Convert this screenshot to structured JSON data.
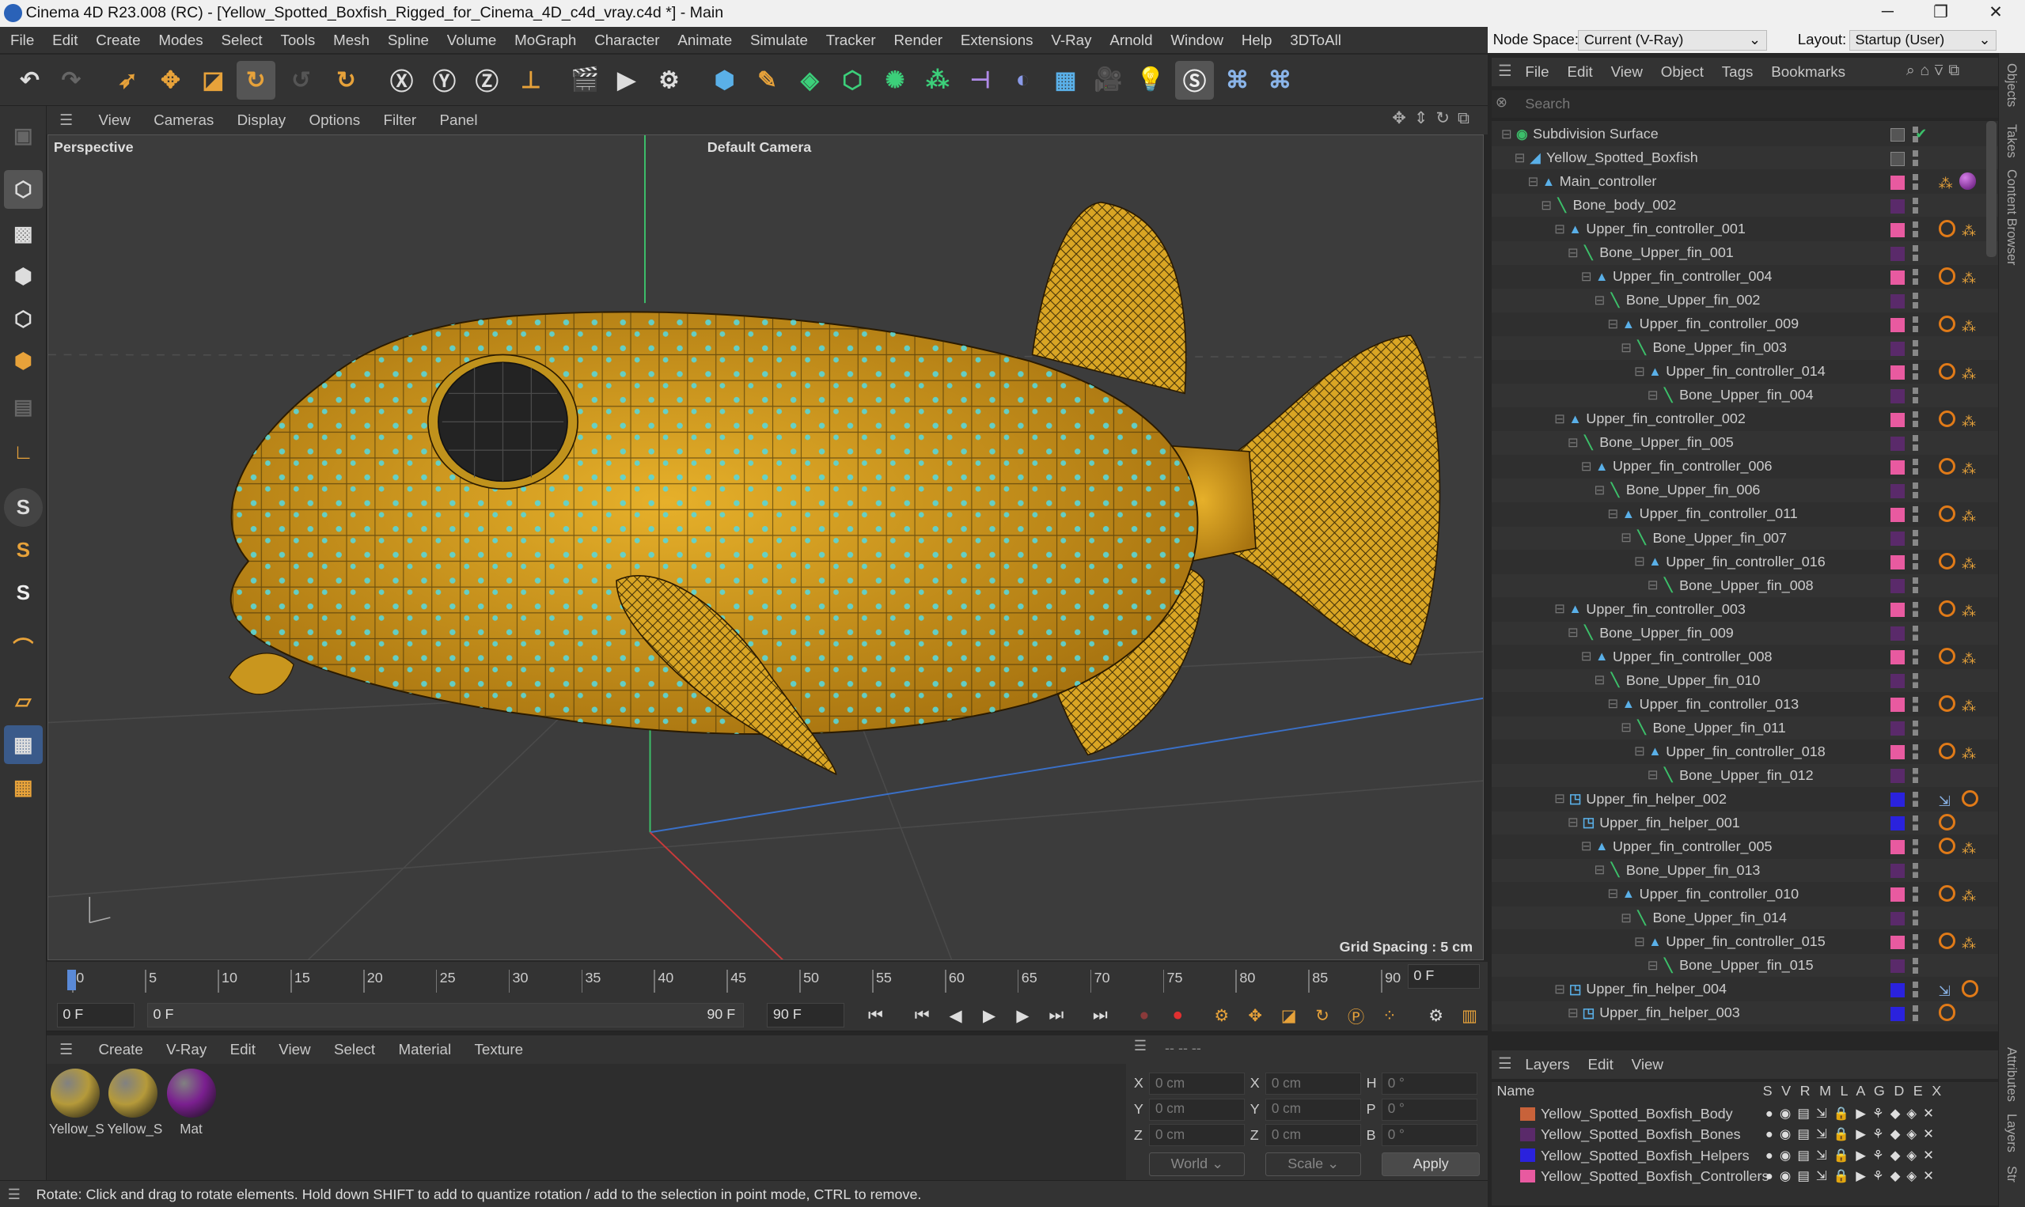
{
  "title_bar": {
    "text": "Cinema 4D R23.008 (RC) - [Yellow_Spotted_Boxfish_Rigged_for_Cinema_4D_c4d_vray.c4d *] - Main",
    "minimize": "─",
    "maximize": "❐",
    "close": "✕"
  },
  "menubar": [
    "File",
    "Edit",
    "Create",
    "Modes",
    "Select",
    "Tools",
    "Mesh",
    "Spline",
    "Volume",
    "MoGraph",
    "Character",
    "Animate",
    "Simulate",
    "Tracker",
    "Render",
    "Extensions",
    "V-Ray",
    "Arnold",
    "Window",
    "Help",
    "3DToAll"
  ],
  "node_space": {
    "label": "Node Space:",
    "value": "Current (V-Ray)"
  },
  "layout": {
    "label": "Layout:",
    "value": "Startup (User)"
  },
  "viewport": {
    "menu": [
      "View",
      "Cameras",
      "Display",
      "Options",
      "Filter",
      "Panel"
    ],
    "label": "Perspective",
    "camera": "Default Camera",
    "grid_spacing": "Grid Spacing : 5 cm"
  },
  "timeline": {
    "ticks": [
      "0",
      "5",
      "10",
      "15",
      "20",
      "25",
      "30",
      "35",
      "40",
      "45",
      "50",
      "55",
      "60",
      "65",
      "70",
      "75",
      "80",
      "85",
      "90"
    ],
    "current_frame": "0 F",
    "start_field": "0 F",
    "range_start": "0 F",
    "range_end": "90 F",
    "end_field": "90 F"
  },
  "material_manager": {
    "menu": [
      "Create",
      "V-Ray",
      "Edit",
      "View",
      "Select",
      "Material",
      "Texture"
    ],
    "materials": [
      {
        "name": "Yellow_S",
        "color": "#b59a3a"
      },
      {
        "name": "Yellow_S",
        "color": "#b59a3a"
      },
      {
        "name": "Mat",
        "color": "#7a1f8f"
      }
    ]
  },
  "coordinates": {
    "header": "--                --                --",
    "rows": [
      {
        "l1": "X",
        "v1": "0 cm",
        "l2": "X",
        "v2": "0 cm",
        "l3": "H",
        "v3": "0 °"
      },
      {
        "l1": "Y",
        "v1": "0 cm",
        "l2": "Y",
        "v2": "0 cm",
        "l3": "P",
        "v3": "0 °"
      },
      {
        "l1": "Z",
        "v1": "0 cm",
        "l2": "Z",
        "v2": "0 cm",
        "l3": "B",
        "v3": "0 °"
      }
    ],
    "world": "World",
    "scale": "Scale",
    "apply": "Apply"
  },
  "status": "Rotate: Click and drag to rotate elements. Hold down SHIFT to add to quantize rotation / add to the selection in point mode, CTRL to remove.",
  "object_manager": {
    "menu": [
      "File",
      "Edit",
      "View",
      "Object",
      "Tags",
      "Bookmarks"
    ],
    "search_placeholder": "Search",
    "tree": [
      {
        "name": "Subdivision Surface",
        "depth": 0,
        "kind": "subd",
        "layer": "",
        "tags": "check"
      },
      {
        "name": "Yellow_Spotted_Boxfish",
        "depth": 1,
        "kind": "poly",
        "layer": "",
        "tags": "none"
      },
      {
        "name": "Main_controller",
        "depth": 2,
        "kind": "null",
        "layer": "#e85aa0",
        "tags": "mat"
      },
      {
        "name": "Bone_body_002",
        "depth": 3,
        "kind": "bone",
        "layer": "#5a2a6a",
        "tags": "none"
      },
      {
        "name": "Upper_fin_controller_001",
        "depth": 4,
        "kind": "null",
        "layer": "#e85aa0",
        "tags": "ik"
      },
      {
        "name": "Bone_Upper_fin_001",
        "depth": 5,
        "kind": "bone",
        "layer": "#5a2a6a",
        "tags": "none"
      },
      {
        "name": "Upper_fin_controller_004",
        "depth": 6,
        "kind": "null",
        "layer": "#e85aa0",
        "tags": "ik"
      },
      {
        "name": "Bone_Upper_fin_002",
        "depth": 7,
        "kind": "bone",
        "layer": "#5a2a6a",
        "tags": "none"
      },
      {
        "name": "Upper_fin_controller_009",
        "depth": 8,
        "kind": "null",
        "layer": "#e85aa0",
        "tags": "ik"
      },
      {
        "name": "Bone_Upper_fin_003",
        "depth": 9,
        "kind": "bone",
        "layer": "#5a2a6a",
        "tags": "none"
      },
      {
        "name": "Upper_fin_controller_014",
        "depth": 10,
        "kind": "null",
        "layer": "#e85aa0",
        "tags": "ik"
      },
      {
        "name": "Bone_Upper_fin_004",
        "depth": 11,
        "kind": "bone",
        "layer": "#5a2a6a",
        "tags": "none"
      },
      {
        "name": "Upper_fin_controller_002",
        "depth": 4,
        "kind": "null",
        "layer": "#e85aa0",
        "tags": "ik"
      },
      {
        "name": "Bone_Upper_fin_005",
        "depth": 5,
        "kind": "bone",
        "layer": "#5a2a6a",
        "tags": "none"
      },
      {
        "name": "Upper_fin_controller_006",
        "depth": 6,
        "kind": "null",
        "layer": "#e85aa0",
        "tags": "ik"
      },
      {
        "name": "Bone_Upper_fin_006",
        "depth": 7,
        "kind": "bone",
        "layer": "#5a2a6a",
        "tags": "none"
      },
      {
        "name": "Upper_fin_controller_011",
        "depth": 8,
        "kind": "null",
        "layer": "#e85aa0",
        "tags": "ik"
      },
      {
        "name": "Bone_Upper_fin_007",
        "depth": 9,
        "kind": "bone",
        "layer": "#5a2a6a",
        "tags": "none"
      },
      {
        "name": "Upper_fin_controller_016",
        "depth": 10,
        "kind": "null",
        "layer": "#e85aa0",
        "tags": "ik"
      },
      {
        "name": "Bone_Upper_fin_008",
        "depth": 11,
        "kind": "bone",
        "layer": "#5a2a6a",
        "tags": "none"
      },
      {
        "name": "Upper_fin_controller_003",
        "depth": 4,
        "kind": "null",
        "layer": "#e85aa0",
        "tags": "ik"
      },
      {
        "name": "Bone_Upper_fin_009",
        "depth": 5,
        "kind": "bone",
        "layer": "#5a2a6a",
        "tags": "none"
      },
      {
        "name": "Upper_fin_controller_008",
        "depth": 6,
        "kind": "null",
        "layer": "#e85aa0",
        "tags": "ik"
      },
      {
        "name": "Bone_Upper_fin_010",
        "depth": 7,
        "kind": "bone",
        "layer": "#5a2a6a",
        "tags": "none"
      },
      {
        "name": "Upper_fin_controller_013",
        "depth": 8,
        "kind": "null",
        "layer": "#e85aa0",
        "tags": "ik"
      },
      {
        "name": "Bone_Upper_fin_011",
        "depth": 9,
        "kind": "bone",
        "layer": "#5a2a6a",
        "tags": "none"
      },
      {
        "name": "Upper_fin_controller_018",
        "depth": 10,
        "kind": "null",
        "layer": "#e85aa0",
        "tags": "ik"
      },
      {
        "name": "Bone_Upper_fin_012",
        "depth": 11,
        "kind": "bone",
        "layer": "#5a2a6a",
        "tags": "none"
      },
      {
        "name": "Upper_fin_helper_002",
        "depth": 4,
        "kind": "helper",
        "layer": "#2a22dd",
        "tags": "helper"
      },
      {
        "name": "Upper_fin_helper_001",
        "depth": 5,
        "kind": "helper",
        "layer": "#2a22dd",
        "tags": "nohelp"
      },
      {
        "name": "Upper_fin_controller_005",
        "depth": 6,
        "kind": "null",
        "layer": "#e85aa0",
        "tags": "ik"
      },
      {
        "name": "Bone_Upper_fin_013",
        "depth": 7,
        "kind": "bone",
        "layer": "#5a2a6a",
        "tags": "none"
      },
      {
        "name": "Upper_fin_controller_010",
        "depth": 8,
        "kind": "null",
        "layer": "#e85aa0",
        "tags": "ik"
      },
      {
        "name": "Bone_Upper_fin_014",
        "depth": 9,
        "kind": "bone",
        "layer": "#5a2a6a",
        "tags": "none"
      },
      {
        "name": "Upper_fin_controller_015",
        "depth": 10,
        "kind": "null",
        "layer": "#e85aa0",
        "tags": "ik"
      },
      {
        "name": "Bone_Upper_fin_015",
        "depth": 11,
        "kind": "bone",
        "layer": "#5a2a6a",
        "tags": "none"
      },
      {
        "name": "Upper_fin_helper_004",
        "depth": 4,
        "kind": "helper",
        "layer": "#2a22dd",
        "tags": "helper"
      },
      {
        "name": "Upper_fin_helper_003",
        "depth": 5,
        "kind": "helper",
        "layer": "#2a22dd",
        "tags": "nohelp"
      }
    ]
  },
  "right_tabs": [
    "Objects",
    "Takes",
    "Content Browser",
    "Attributes",
    "Layers",
    "Str"
  ],
  "layer_manager": {
    "menu": [
      "Layers",
      "Edit",
      "View"
    ],
    "columns": {
      "name": "Name",
      "flags": "S V R M L A G D E X"
    },
    "layers": [
      {
        "name": "Yellow_Spotted_Boxfish_Body",
        "color": "#c8623a"
      },
      {
        "name": "Yellow_Spotted_Boxfish_Bones",
        "color": "#5a2a6a"
      },
      {
        "name": "Yellow_Spotted_Boxfish_Helpers",
        "color": "#2a22dd"
      },
      {
        "name": "Yellow_Spotted_Boxfish_Controllers",
        "color": "#e85aa0"
      }
    ]
  }
}
